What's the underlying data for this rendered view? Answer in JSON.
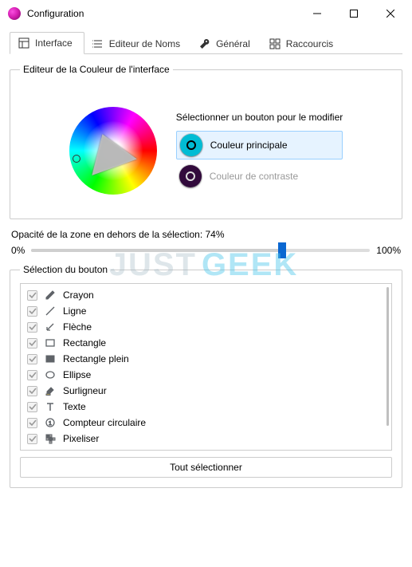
{
  "window": {
    "title": "Configuration"
  },
  "tabs": {
    "interface": "Interface",
    "name_editor": "Editeur de Noms",
    "general": "Général",
    "shortcuts": "Raccourcis"
  },
  "color_editor": {
    "legend": "Editeur de la Couleur de l'interface",
    "hint": "Sélectionner un bouton pour le modifier",
    "primary_label": "Couleur principale",
    "contrast_label": "Couleur de contraste",
    "primary_color": "#00bcd4",
    "contrast_color": "#320a3c"
  },
  "opacity": {
    "label_prefix": "Opacité de la zone en dehors de la sélection: ",
    "value_text": "74%",
    "min_label": "0%",
    "max_label": "100%",
    "value": 74
  },
  "button_selection": {
    "legend": "Sélection du bouton",
    "items": [
      {
        "label": "Crayon"
      },
      {
        "label": "Ligne"
      },
      {
        "label": "Flèche"
      },
      {
        "label": "Rectangle"
      },
      {
        "label": "Rectangle plein"
      },
      {
        "label": "Ellipse"
      },
      {
        "label": "Surligneur"
      },
      {
        "label": "Texte"
      },
      {
        "label": "Compteur circulaire"
      },
      {
        "label": "Pixeliser"
      }
    ],
    "select_all": "Tout sélectionner"
  },
  "watermark": {
    "a": "JUST",
    "b": "GEEK"
  }
}
